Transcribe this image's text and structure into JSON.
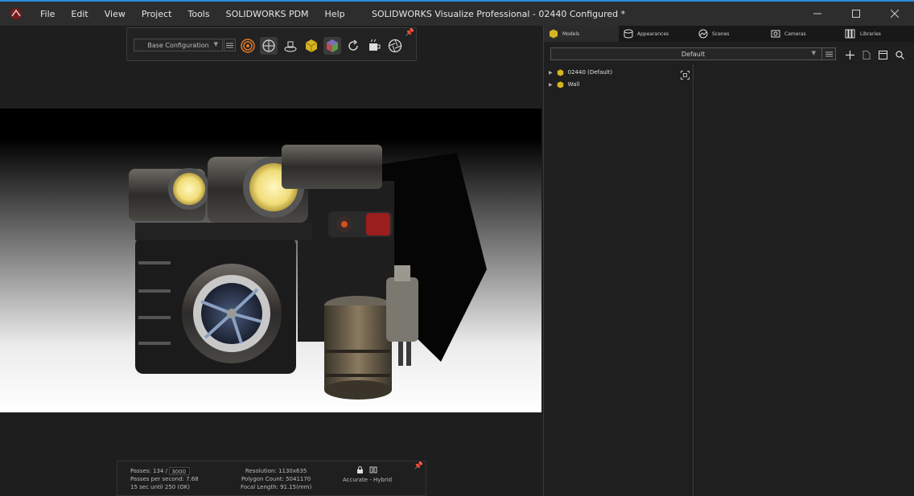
{
  "window": {
    "title": "SOLIDWORKS Visualize Professional - 02440 Configured *",
    "menu": [
      "File",
      "Edit",
      "View",
      "Project",
      "Tools",
      "SOLIDWORKS PDM",
      "Help"
    ]
  },
  "toolbar": {
    "configuration": "Base Configuration"
  },
  "status": {
    "passes_label": "Passes: 134 /",
    "passes_target": "3000",
    "passes_per_second": "Passes per second: 7.68",
    "time_until": "15 sec until 250 (OK)",
    "resolution": "Resolution: 1130x635",
    "polygon_count": "Polygon Count: 5041170",
    "focal_length": "Focal Length: 91.15(mm)",
    "render_mode": "Accurate - Hybrid"
  },
  "panel": {
    "tabs": [
      "Models",
      "Appearances",
      "Scenes",
      "Cameras",
      "Libraries"
    ],
    "dropdown": "Default",
    "tree": [
      "02440 (Default)",
      "Wall"
    ]
  },
  "colors": {
    "accent": "#2a8de0",
    "cube_yellow": "#d6b421"
  }
}
